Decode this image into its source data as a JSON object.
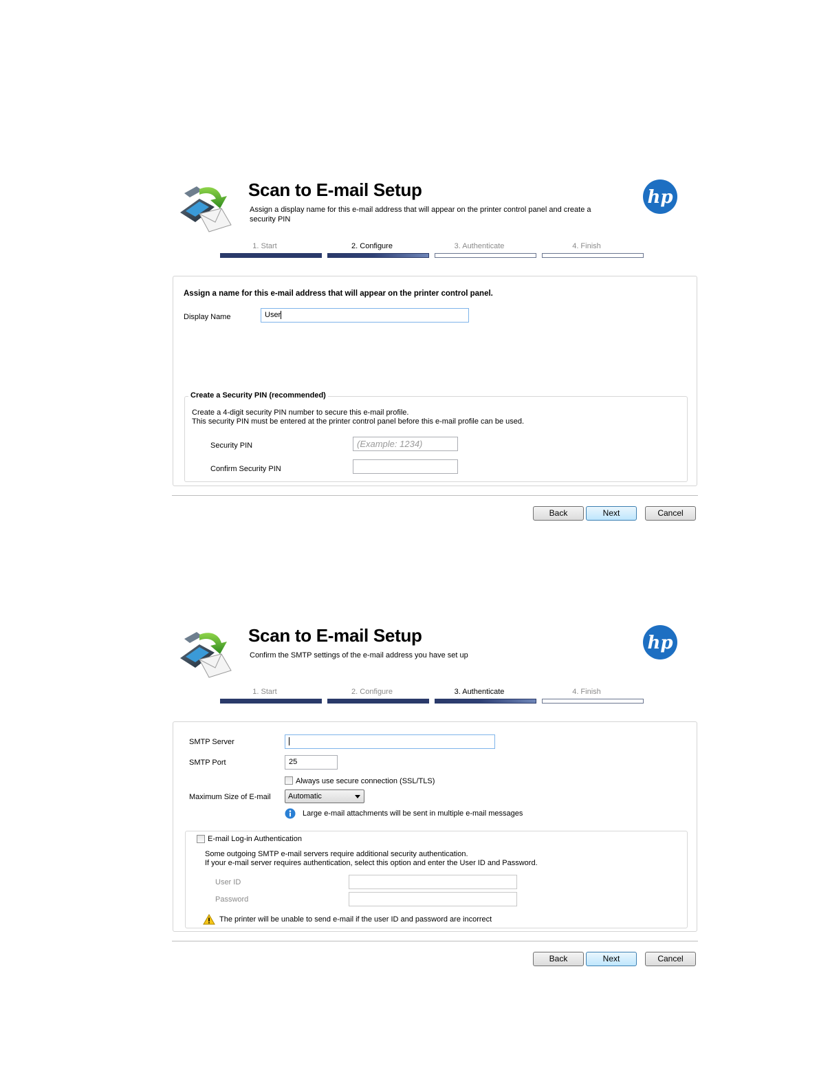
{
  "screen1": {
    "title": "Scan to E-mail Setup",
    "subtitle": "Assign a display name for this e-mail address that will appear on the printer control panel and create a security PIN",
    "steps": [
      {
        "label": "1. Start",
        "state": "done"
      },
      {
        "label": "2. Configure",
        "state": "current"
      },
      {
        "label": "3. Authenticate",
        "state": "todo"
      },
      {
        "label": "4. Finish",
        "state": "todo"
      }
    ],
    "heading": "Assign a name for this e-mail address that will appear on the printer control panel.",
    "display_name_label": "Display Name",
    "display_name_value": "User",
    "pin_group_title": "Create a Security PIN (recommended)",
    "pin_desc_line1": "Create a 4-digit security PIN number to secure this e-mail profile.",
    "pin_desc_line2": "This security PIN must be entered at the printer control panel before this e-mail profile can be used.",
    "security_pin_label": "Security PIN",
    "security_pin_placeholder": "(Example: 1234)",
    "confirm_pin_label": "Confirm Security PIN",
    "back_label": "Back",
    "next_label": "Next",
    "cancel_label": "Cancel"
  },
  "screen2": {
    "title": "Scan to E-mail Setup",
    "subtitle": "Confirm the SMTP settings of the e-mail address you have set up",
    "steps": [
      {
        "label": "1. Start",
        "state": "done"
      },
      {
        "label": "2. Configure",
        "state": "done"
      },
      {
        "label": "3. Authenticate",
        "state": "current"
      },
      {
        "label": "4. Finish",
        "state": "todo"
      }
    ],
    "smtp_server_label": "SMTP Server",
    "smtp_server_value": "",
    "smtp_port_label": "SMTP Port",
    "smtp_port_value": "25",
    "secure_conn_label": "Always use secure connection (SSL/TLS)",
    "max_size_label": "Maximum Size of E-mail",
    "max_size_value": "Automatic",
    "info_text": "Large e-mail attachments will be sent in multiple e-mail messages",
    "auth_label": "E-mail Log-in Authentication",
    "auth_desc_line1": "Some outgoing SMTP e-mail servers require additional security authentication.",
    "auth_desc_line2": "If your e-mail server requires authentication, select this option and enter the User ID and Password.",
    "user_id_label": "User ID",
    "password_label": "Password",
    "warning_text": "The printer will be unable to send e-mail if the user ID and password are incorrect",
    "back_label": "Back",
    "next_label": "Next",
    "cancel_label": "Cancel"
  },
  "colors": {
    "step_done": "#2a3a6a",
    "hp_blue": "#1d6fc2",
    "button_focus_border": "#3c7fb1"
  },
  "icons": [
    "scan-email-icon",
    "hp-logo-icon",
    "info-icon",
    "warning-icon",
    "dropdown-arrow-icon"
  ]
}
